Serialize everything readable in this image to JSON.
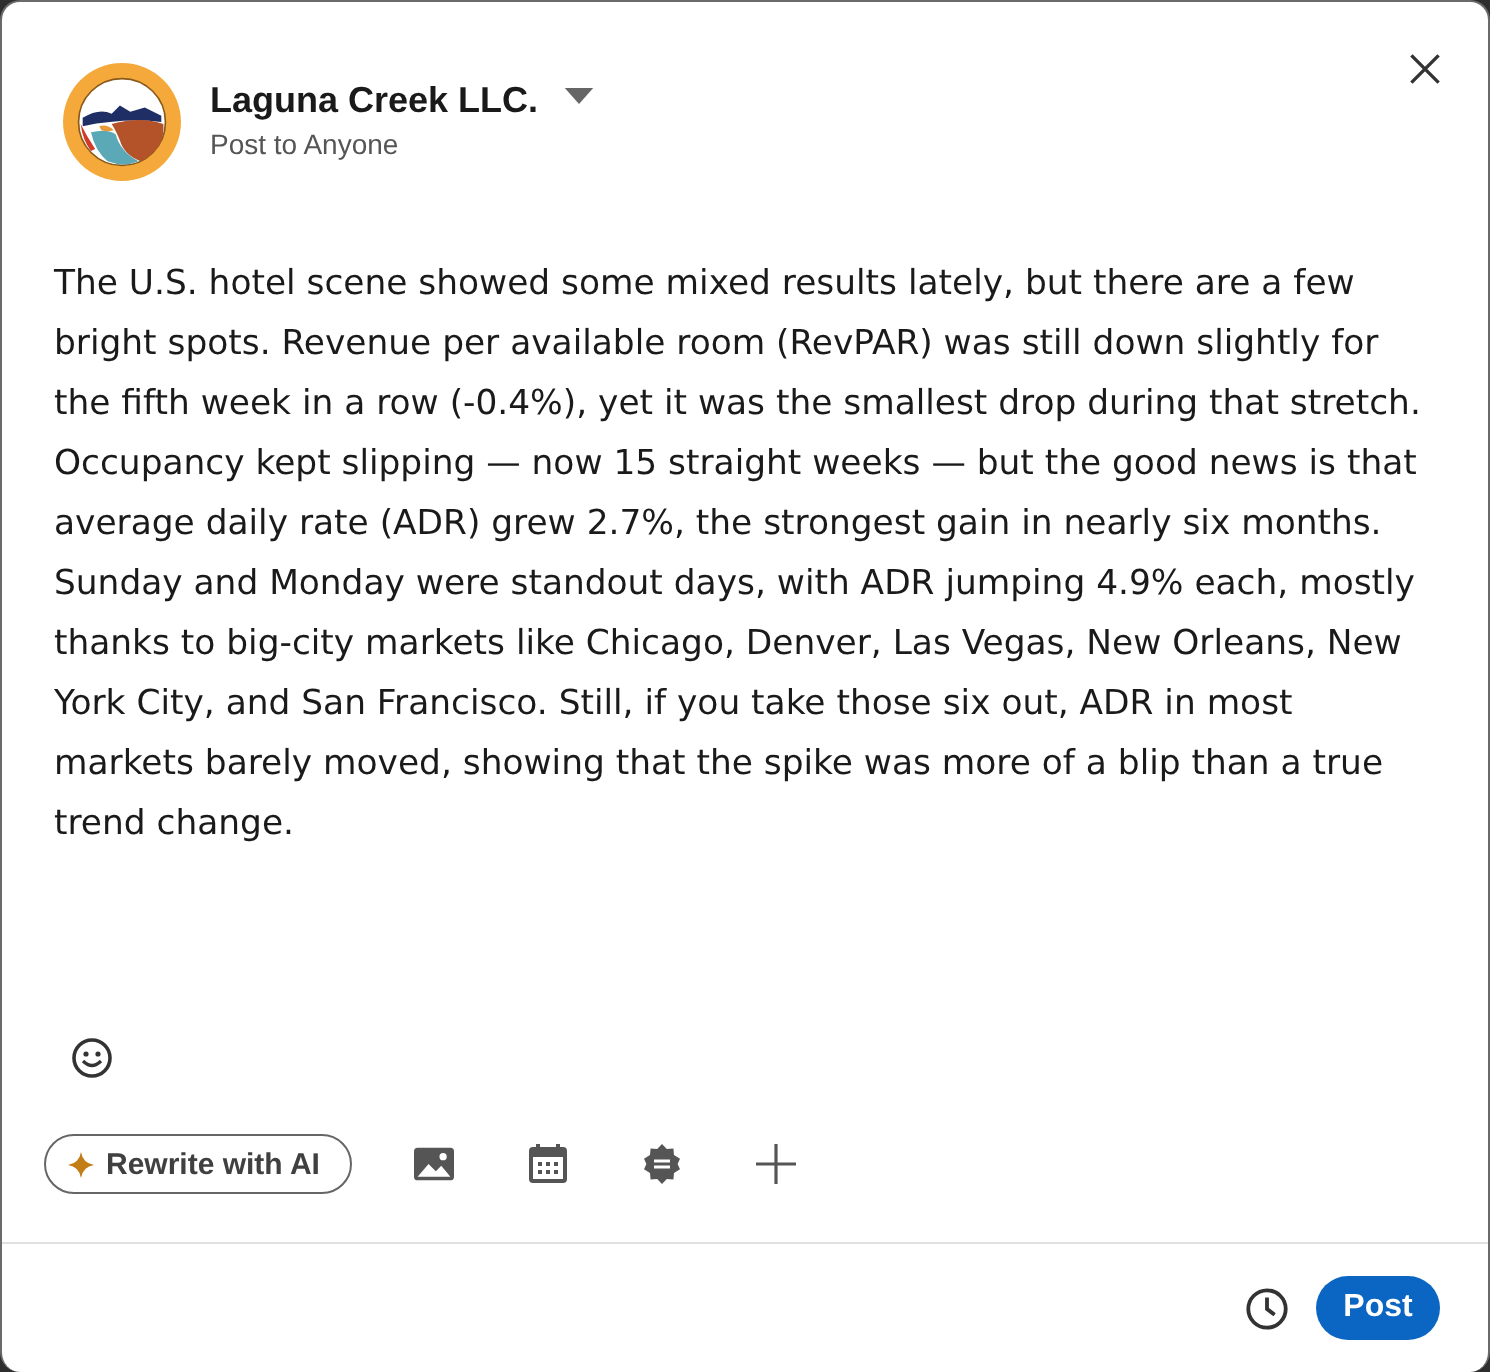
{
  "author": {
    "name": "Laguna Creek LLC.",
    "audience": "Post to Anyone"
  },
  "post": {
    "paragraphs": [
      "The U.S. hotel scene showed some mixed results lately, but there are a few bright spots. Revenue per available room (RevPAR) was still down slightly for the fifth week in a row (-0.4%), yet it was the smallest drop during that stretch. Occupancy kept slipping — now 15 straight weeks — but the good news is that average daily rate (ADR) grew 2.7%, the strongest gain in nearly six months.",
      "Sunday and Monday were standout days, with ADR jumping 4.9% each, mostly thanks to big-city markets like Chicago, Denver, Las Vegas, New Orleans, New York City, and San Francisco. Still, if you take those six out, ADR in most markets barely moved, showing that the spike was more of a blip than a true trend change."
    ]
  },
  "toolbar": {
    "ai_button": {
      "label": "Rewrite with AI"
    }
  },
  "footer": {
    "post_button": {
      "label": "Post"
    }
  }
}
